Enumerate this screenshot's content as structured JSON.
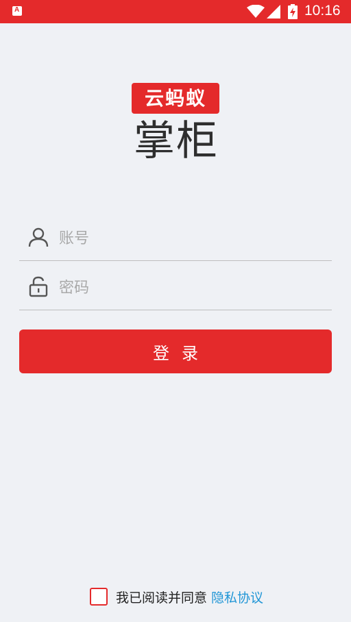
{
  "status_bar": {
    "app_icon_letter": "A",
    "time": "10:16",
    "icons": [
      "wifi-icon",
      "signal-icon",
      "battery-charging-icon"
    ]
  },
  "logo": {
    "badge_text": "云蚂蚁",
    "main_text": "掌柜"
  },
  "form": {
    "account_placeholder": "账号",
    "password_placeholder": "密码",
    "account_value": "",
    "password_value": "",
    "login_label": "登录"
  },
  "agreement": {
    "checked": false,
    "text": "我已阅读并同意",
    "link_text": "隐私协议"
  },
  "colors": {
    "accent": "#e42a2b",
    "background": "#eff1f5",
    "link": "#2196d6"
  }
}
